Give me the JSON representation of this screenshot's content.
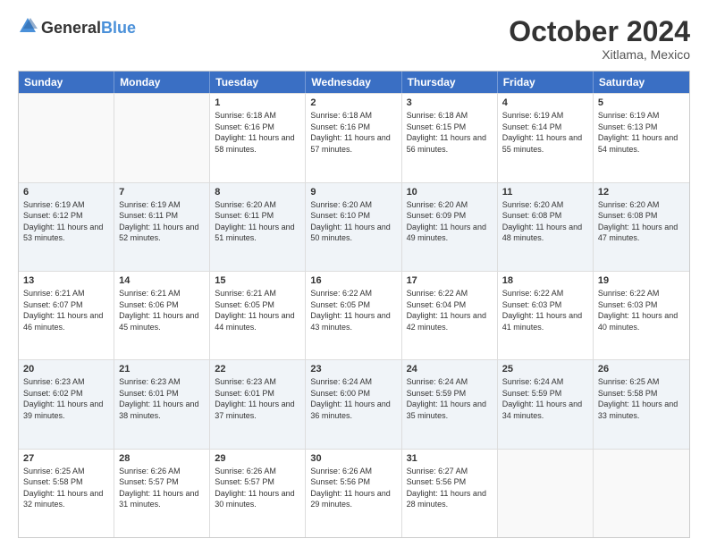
{
  "header": {
    "logo_general": "General",
    "logo_blue": "Blue",
    "month": "October 2024",
    "location": "Xitlama, Mexico"
  },
  "weekdays": [
    "Sunday",
    "Monday",
    "Tuesday",
    "Wednesday",
    "Thursday",
    "Friday",
    "Saturday"
  ],
  "rows": [
    [
      {
        "day": "",
        "sunrise": "",
        "sunset": "",
        "daylight": "",
        "empty": true
      },
      {
        "day": "",
        "sunrise": "",
        "sunset": "",
        "daylight": "",
        "empty": true
      },
      {
        "day": "1",
        "sunrise": "Sunrise: 6:18 AM",
        "sunset": "Sunset: 6:16 PM",
        "daylight": "Daylight: 11 hours and 58 minutes.",
        "empty": false
      },
      {
        "day": "2",
        "sunrise": "Sunrise: 6:18 AM",
        "sunset": "Sunset: 6:16 PM",
        "daylight": "Daylight: 11 hours and 57 minutes.",
        "empty": false
      },
      {
        "day": "3",
        "sunrise": "Sunrise: 6:18 AM",
        "sunset": "Sunset: 6:15 PM",
        "daylight": "Daylight: 11 hours and 56 minutes.",
        "empty": false
      },
      {
        "day": "4",
        "sunrise": "Sunrise: 6:19 AM",
        "sunset": "Sunset: 6:14 PM",
        "daylight": "Daylight: 11 hours and 55 minutes.",
        "empty": false
      },
      {
        "day": "5",
        "sunrise": "Sunrise: 6:19 AM",
        "sunset": "Sunset: 6:13 PM",
        "daylight": "Daylight: 11 hours and 54 minutes.",
        "empty": false
      }
    ],
    [
      {
        "day": "6",
        "sunrise": "Sunrise: 6:19 AM",
        "sunset": "Sunset: 6:12 PM",
        "daylight": "Daylight: 11 hours and 53 minutes.",
        "empty": false
      },
      {
        "day": "7",
        "sunrise": "Sunrise: 6:19 AM",
        "sunset": "Sunset: 6:11 PM",
        "daylight": "Daylight: 11 hours and 52 minutes.",
        "empty": false
      },
      {
        "day": "8",
        "sunrise": "Sunrise: 6:20 AM",
        "sunset": "Sunset: 6:11 PM",
        "daylight": "Daylight: 11 hours and 51 minutes.",
        "empty": false
      },
      {
        "day": "9",
        "sunrise": "Sunrise: 6:20 AM",
        "sunset": "Sunset: 6:10 PM",
        "daylight": "Daylight: 11 hours and 50 minutes.",
        "empty": false
      },
      {
        "day": "10",
        "sunrise": "Sunrise: 6:20 AM",
        "sunset": "Sunset: 6:09 PM",
        "daylight": "Daylight: 11 hours and 49 minutes.",
        "empty": false
      },
      {
        "day": "11",
        "sunrise": "Sunrise: 6:20 AM",
        "sunset": "Sunset: 6:08 PM",
        "daylight": "Daylight: 11 hours and 48 minutes.",
        "empty": false
      },
      {
        "day": "12",
        "sunrise": "Sunrise: 6:20 AM",
        "sunset": "Sunset: 6:08 PM",
        "daylight": "Daylight: 11 hours and 47 minutes.",
        "empty": false
      }
    ],
    [
      {
        "day": "13",
        "sunrise": "Sunrise: 6:21 AM",
        "sunset": "Sunset: 6:07 PM",
        "daylight": "Daylight: 11 hours and 46 minutes.",
        "empty": false
      },
      {
        "day": "14",
        "sunrise": "Sunrise: 6:21 AM",
        "sunset": "Sunset: 6:06 PM",
        "daylight": "Daylight: 11 hours and 45 minutes.",
        "empty": false
      },
      {
        "day": "15",
        "sunrise": "Sunrise: 6:21 AM",
        "sunset": "Sunset: 6:05 PM",
        "daylight": "Daylight: 11 hours and 44 minutes.",
        "empty": false
      },
      {
        "day": "16",
        "sunrise": "Sunrise: 6:22 AM",
        "sunset": "Sunset: 6:05 PM",
        "daylight": "Daylight: 11 hours and 43 minutes.",
        "empty": false
      },
      {
        "day": "17",
        "sunrise": "Sunrise: 6:22 AM",
        "sunset": "Sunset: 6:04 PM",
        "daylight": "Daylight: 11 hours and 42 minutes.",
        "empty": false
      },
      {
        "day": "18",
        "sunrise": "Sunrise: 6:22 AM",
        "sunset": "Sunset: 6:03 PM",
        "daylight": "Daylight: 11 hours and 41 minutes.",
        "empty": false
      },
      {
        "day": "19",
        "sunrise": "Sunrise: 6:22 AM",
        "sunset": "Sunset: 6:03 PM",
        "daylight": "Daylight: 11 hours and 40 minutes.",
        "empty": false
      }
    ],
    [
      {
        "day": "20",
        "sunrise": "Sunrise: 6:23 AM",
        "sunset": "Sunset: 6:02 PM",
        "daylight": "Daylight: 11 hours and 39 minutes.",
        "empty": false
      },
      {
        "day": "21",
        "sunrise": "Sunrise: 6:23 AM",
        "sunset": "Sunset: 6:01 PM",
        "daylight": "Daylight: 11 hours and 38 minutes.",
        "empty": false
      },
      {
        "day": "22",
        "sunrise": "Sunrise: 6:23 AM",
        "sunset": "Sunset: 6:01 PM",
        "daylight": "Daylight: 11 hours and 37 minutes.",
        "empty": false
      },
      {
        "day": "23",
        "sunrise": "Sunrise: 6:24 AM",
        "sunset": "Sunset: 6:00 PM",
        "daylight": "Daylight: 11 hours and 36 minutes.",
        "empty": false
      },
      {
        "day": "24",
        "sunrise": "Sunrise: 6:24 AM",
        "sunset": "Sunset: 5:59 PM",
        "daylight": "Daylight: 11 hours and 35 minutes.",
        "empty": false
      },
      {
        "day": "25",
        "sunrise": "Sunrise: 6:24 AM",
        "sunset": "Sunset: 5:59 PM",
        "daylight": "Daylight: 11 hours and 34 minutes.",
        "empty": false
      },
      {
        "day": "26",
        "sunrise": "Sunrise: 6:25 AM",
        "sunset": "Sunset: 5:58 PM",
        "daylight": "Daylight: 11 hours and 33 minutes.",
        "empty": false
      }
    ],
    [
      {
        "day": "27",
        "sunrise": "Sunrise: 6:25 AM",
        "sunset": "Sunset: 5:58 PM",
        "daylight": "Daylight: 11 hours and 32 minutes.",
        "empty": false
      },
      {
        "day": "28",
        "sunrise": "Sunrise: 6:26 AM",
        "sunset": "Sunset: 5:57 PM",
        "daylight": "Daylight: 11 hours and 31 minutes.",
        "empty": false
      },
      {
        "day": "29",
        "sunrise": "Sunrise: 6:26 AM",
        "sunset": "Sunset: 5:57 PM",
        "daylight": "Daylight: 11 hours and 30 minutes.",
        "empty": false
      },
      {
        "day": "30",
        "sunrise": "Sunrise: 6:26 AM",
        "sunset": "Sunset: 5:56 PM",
        "daylight": "Daylight: 11 hours and 29 minutes.",
        "empty": false
      },
      {
        "day": "31",
        "sunrise": "Sunrise: 6:27 AM",
        "sunset": "Sunset: 5:56 PM",
        "daylight": "Daylight: 11 hours and 28 minutes.",
        "empty": false
      },
      {
        "day": "",
        "sunrise": "",
        "sunset": "",
        "daylight": "",
        "empty": true
      },
      {
        "day": "",
        "sunrise": "",
        "sunset": "",
        "daylight": "",
        "empty": true
      }
    ]
  ]
}
